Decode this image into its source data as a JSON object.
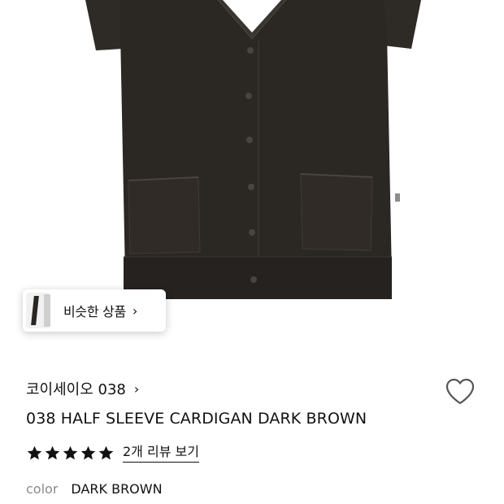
{
  "similar": {
    "label": "비슷한 상품",
    "chevron": "›"
  },
  "product": {
    "brand": "코이세이오 038",
    "brand_chevron": "›",
    "title": "038 HALF SLEEVE CARDIGAN DARK BROWN",
    "rating": 5,
    "review_link": "2개 리뷰 보기",
    "color_key": "color",
    "color_value": "DARK BROWN",
    "garment_color": "#2b2723",
    "heart_color": "#555555"
  }
}
